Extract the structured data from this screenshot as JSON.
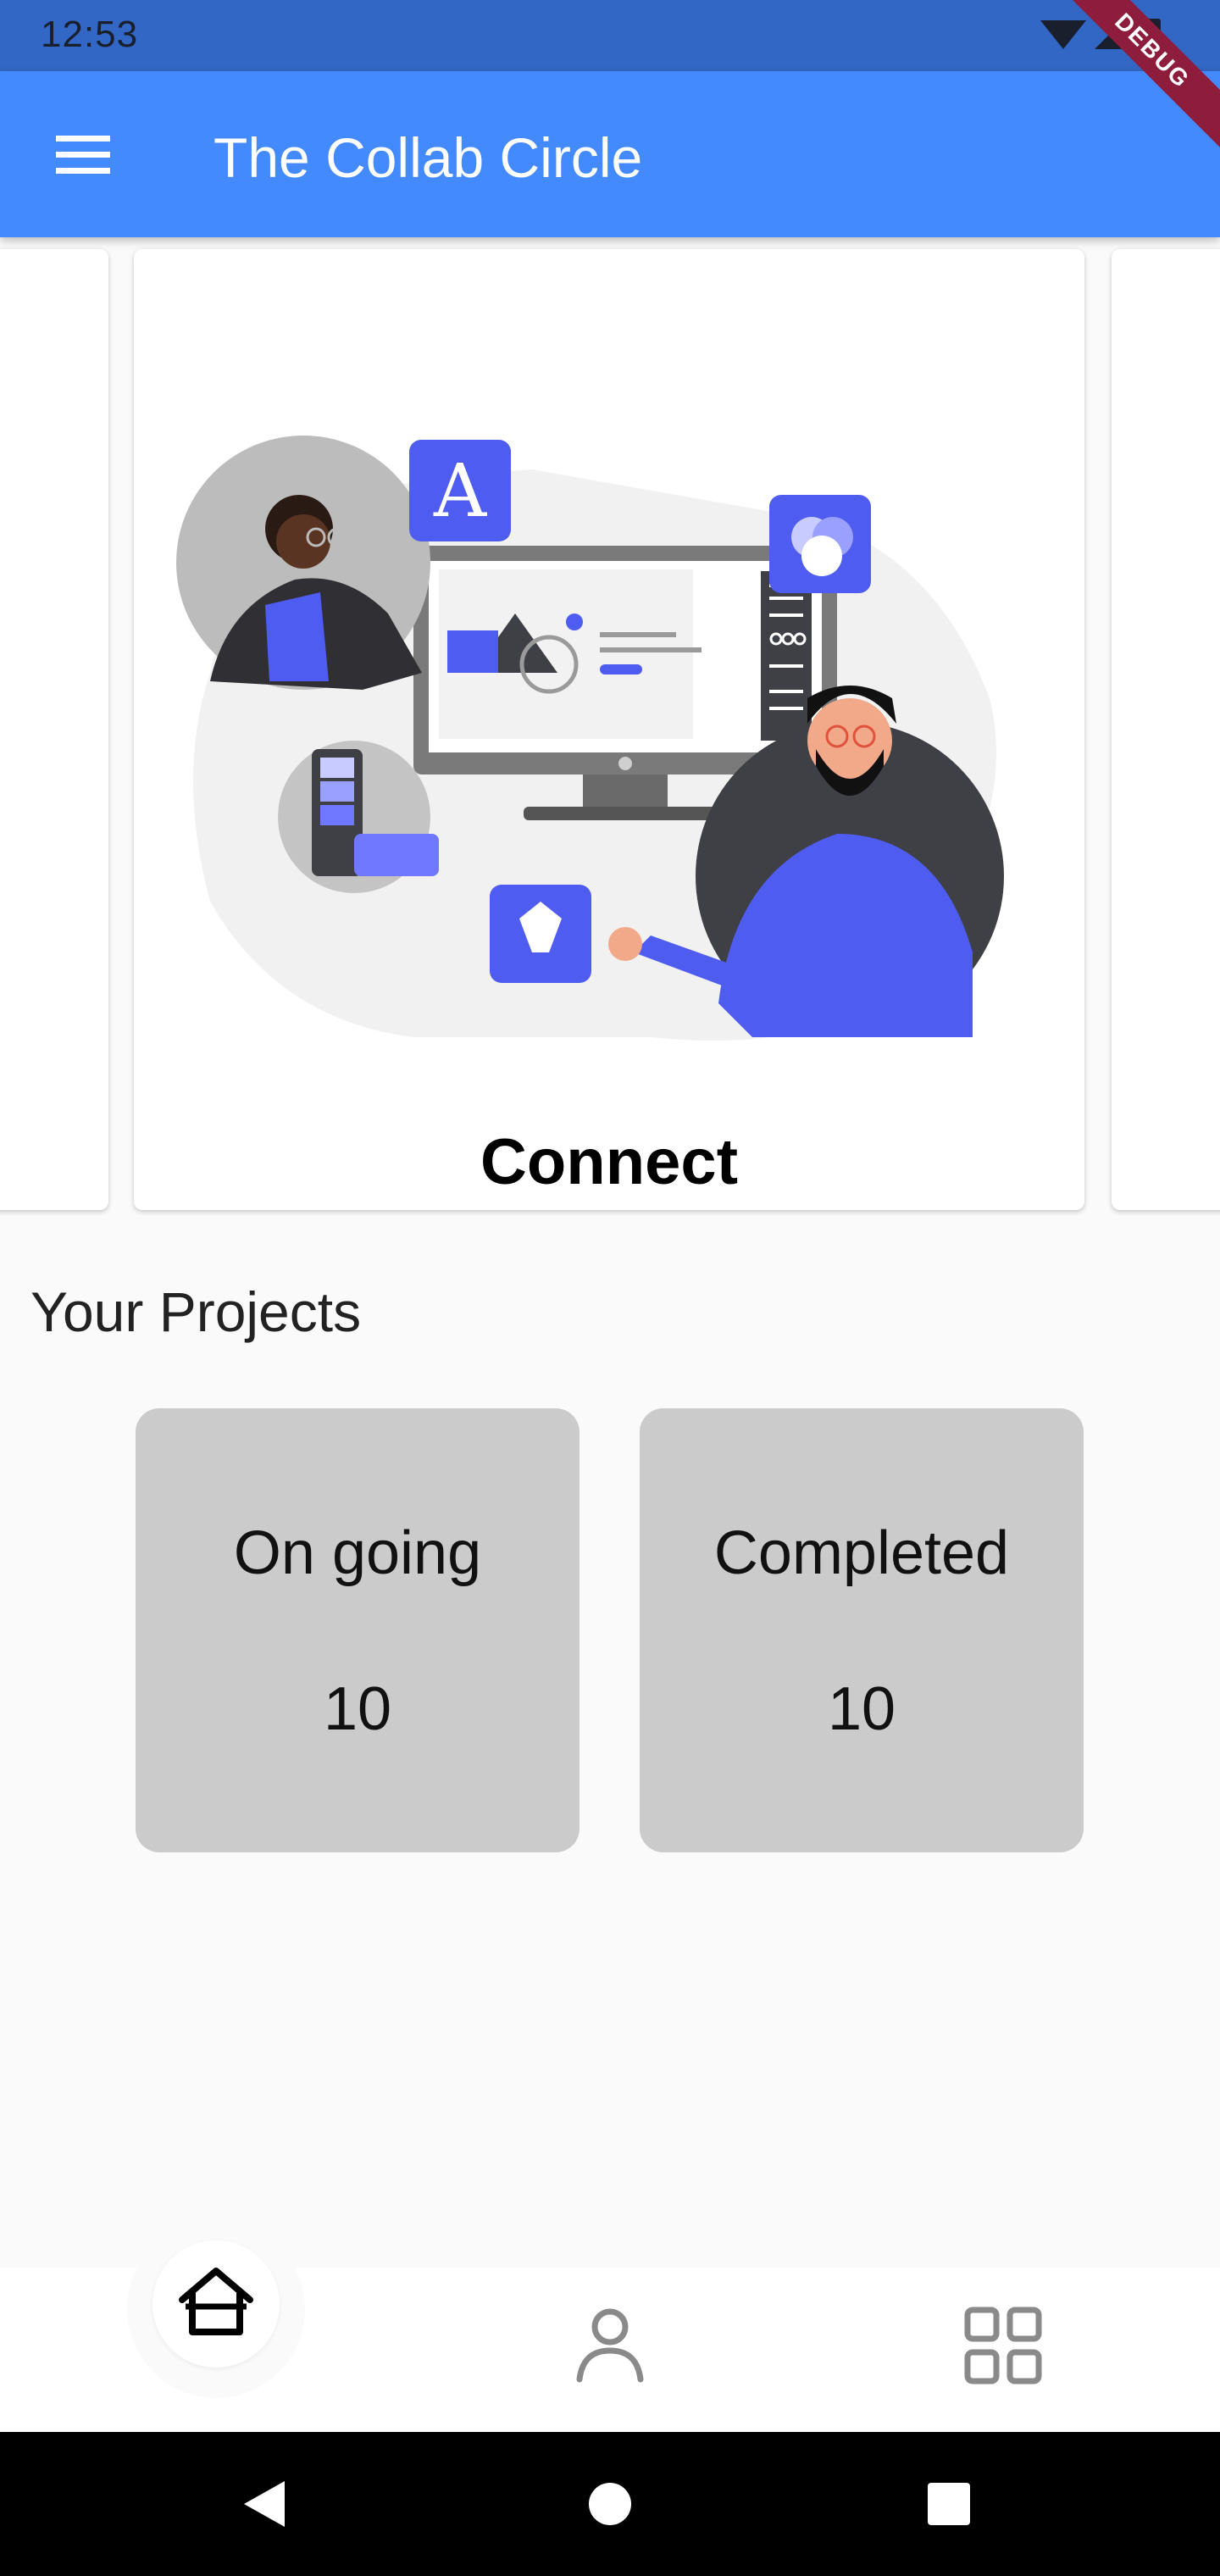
{
  "status_bar": {
    "time": "12:53",
    "debug_label": "DEBUG"
  },
  "app_bar": {
    "title": "The Collab Circle",
    "menu_icon": "hamburger-menu-icon"
  },
  "carousel": {
    "cards": [
      {
        "title": ""
      },
      {
        "title": "Connect",
        "illustration": "collaboration-illustration"
      },
      {
        "title": ""
      }
    ]
  },
  "projects": {
    "section_title": "Your Projects",
    "stats": [
      {
        "label": "On going",
        "value": "10"
      },
      {
        "label": "Completed",
        "value": "10"
      }
    ]
  },
  "bottom_nav": {
    "items": [
      {
        "icon": "home-icon",
        "active": true
      },
      {
        "icon": "profile-icon",
        "active": false
      },
      {
        "icon": "grid-icon",
        "active": false
      }
    ]
  },
  "colors": {
    "status_bar": "#3367c5",
    "app_bar": "#448aff",
    "accent": "#4f5cf0",
    "stat_card": "#cbcbcb",
    "debug_banner": "#8e1c3c"
  }
}
